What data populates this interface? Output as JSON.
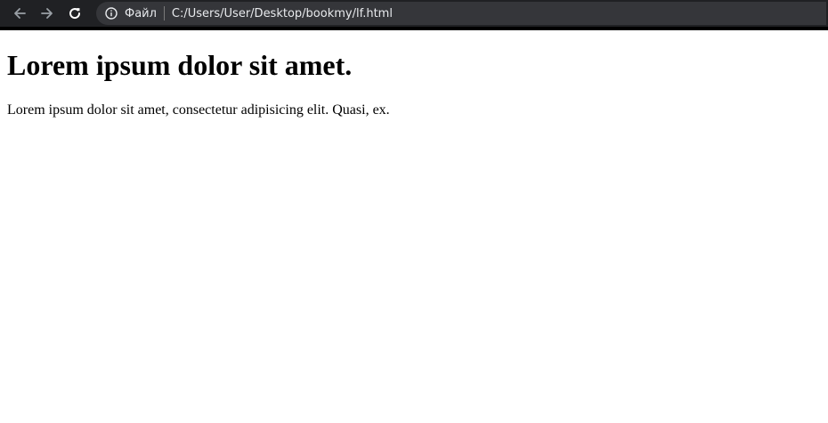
{
  "browser": {
    "icons": {
      "back": "arrow-left-icon",
      "forward": "arrow-right-icon",
      "reload": "reload-icon",
      "site_info": "info-icon"
    },
    "address_bar": {
      "scheme_label": "Файл",
      "url": "C:/Users/User/Desktop/bookmy/lf.html"
    },
    "colors": {
      "toolbar": "#202124",
      "omnibox": "#35363a",
      "text": "#e8eaed",
      "disabled_icon": "#9aa0a6"
    }
  },
  "page": {
    "heading": "Lorem ipsum dolor sit amet.",
    "paragraph": "Lorem ipsum dolor sit amet, consectetur adipisicing elit. Quasi, ex."
  }
}
